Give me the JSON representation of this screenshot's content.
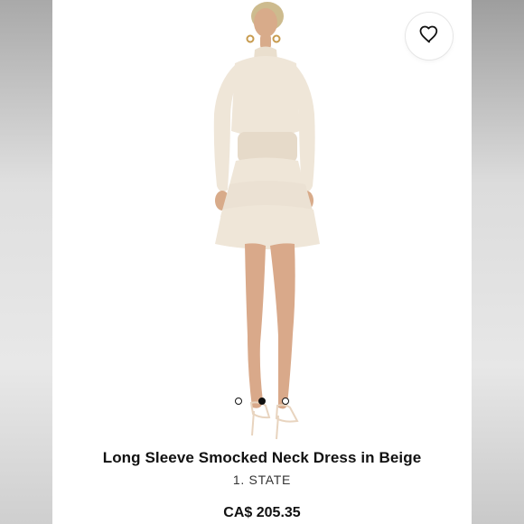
{
  "product": {
    "title": "Long Sleeve Smocked Neck Dress in Beige",
    "brand": "1. STATE",
    "price": "CA$ 205.35"
  },
  "gallery": {
    "total_slides": 3,
    "active_slide": 2
  },
  "icons": {
    "wishlist": "heart-icon"
  },
  "colors": {
    "background": "#ffffff",
    "text": "#111111",
    "dress": "#eadfce",
    "skin": "#d9a98a"
  }
}
